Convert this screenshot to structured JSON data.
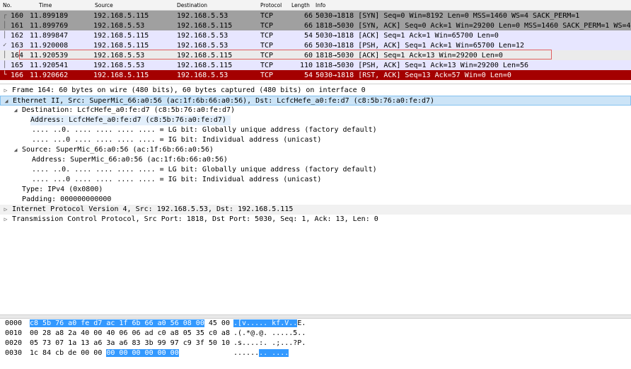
{
  "packet_list": {
    "headers": {
      "no": "No.",
      "time": "Time",
      "source": "Source",
      "destination": "Destination",
      "protocol": "Protocol",
      "length": "Length",
      "info": "Info"
    },
    "rows": [
      {
        "no": "160",
        "time": "11.899189",
        "src": "192.168.5.115",
        "dst": "192.168.5.53",
        "proto": "TCP",
        "len": "66",
        "info": "5030→1818 [SYN] Seq=0 Win=8192 Len=0 MSS=1460 WS=4 SACK_PERM=1"
      },
      {
        "no": "161",
        "time": "11.899769",
        "src": "192.168.5.53",
        "dst": "192.168.5.115",
        "proto": "TCP",
        "len": "66",
        "info": "1818→5030 [SYN, ACK] Seq=0 Ack=1 Win=29200 Len=0 MSS=1460 SACK_PERM=1 WS=4"
      },
      {
        "no": "162",
        "time": "11.899847",
        "src": "192.168.5.115",
        "dst": "192.168.5.53",
        "proto": "TCP",
        "len": "54",
        "info": "5030→1818 [ACK] Seq=1 Ack=1 Win=65700 Len=0"
      },
      {
        "no": "163",
        "time": "11.920008",
        "src": "192.168.5.115",
        "dst": "192.168.5.53",
        "proto": "TCP",
        "len": "66",
        "info": "5030→1818 [PSH, ACK] Seq=1 Ack=1 Win=65700 Len=12"
      },
      {
        "no": "164",
        "time": "11.920539",
        "src": "192.168.5.53",
        "dst": "192.168.5.115",
        "proto": "TCP",
        "len": "60",
        "info": "1818→5030 [ACK] Seq=1 Ack=13 Win=29200 Len=0"
      },
      {
        "no": "165",
        "time": "11.920541",
        "src": "192.168.5.53",
        "dst": "192.168.5.115",
        "proto": "TCP",
        "len": "110",
        "info": "1818→5030 [PSH, ACK] Seq=1 Ack=13 Win=29200 Len=56"
      },
      {
        "no": "166",
        "time": "11.920662",
        "src": "192.168.5.115",
        "dst": "192.168.5.53",
        "proto": "TCP",
        "len": "54",
        "info": "5030→1818 [RST, ACK] Seq=13 Ack=57 Win=0 Len=0"
      }
    ]
  },
  "details": {
    "frame": "Frame 164: 60 bytes on wire (480 bits), 60 bytes captured (480 bits) on interface 0",
    "ethernet": "Ethernet II, Src: SuperMic_66:a0:56 (ac:1f:6b:66:a0:56), Dst: LcfcHefe_a0:fe:d7 (c8:5b:76:a0:fe:d7)",
    "destination": "Destination: LcfcHefe_a0:fe:d7 (c8:5b:76:a0:fe:d7)",
    "dst_address": "Address: LcfcHefe_a0:fe:d7 (c8:5b:76:a0:fe:d7)",
    "dst_lg": ".... ..0. .... .... .... .... = LG bit: Globally unique address (factory default)",
    "dst_ig": ".... ...0 .... .... .... .... = IG bit: Individual address (unicast)",
    "source": "Source: SuperMic_66:a0:56 (ac:1f:6b:66:a0:56)",
    "src_address": "Address: SuperMic_66:a0:56 (ac:1f:6b:66:a0:56)",
    "src_lg": ".... ..0. .... .... .... .... = LG bit: Globally unique address (factory default)",
    "src_ig": ".... ...0 .... .... .... .... = IG bit: Individual address (unicast)",
    "type": "Type: IPv4 (0x0800)",
    "padding": "Padding: 000000000000",
    "ip": "Internet Protocol Version 4, Src: 192.168.5.53, Dst: 192.168.5.115",
    "tcp": "Transmission Control Protocol, Src Port: 1818, Dst Port: 5030, Seq: 1, Ack: 13, Len: 0"
  },
  "bytes": {
    "rows": [
      {
        "offset": "0000",
        "hex_hl": "c8 5b 76 a0 fe d7 ac 1f  6b 66 a0 56 08 00",
        "hex_rest": " 45 00",
        "ascii_hl": ".[v..... kf.V..",
        "ascii_rest": "E."
      },
      {
        "offset": "0010",
        "hex_pre": "00 28 a8 2a 40 00 40 06  06 ad c0 a8 05 35 c0 a8",
        "ascii_pre": ".(.*@.@. .....5.."
      },
      {
        "offset": "0020",
        "hex_pre": "05 73 07 1a 13 a6 3a a6  83 3b 99 97 c9 3f 50 10",
        "ascii_pre": ".s....:. .;...?P."
      },
      {
        "offset": "0030",
        "hex_pre": "1c 84 cb de 00 00 ",
        "hex_hl": "00 00  00 00 00 00",
        "ascii_pre": "......",
        "ascii_hl": ".. ...."
      }
    ]
  }
}
